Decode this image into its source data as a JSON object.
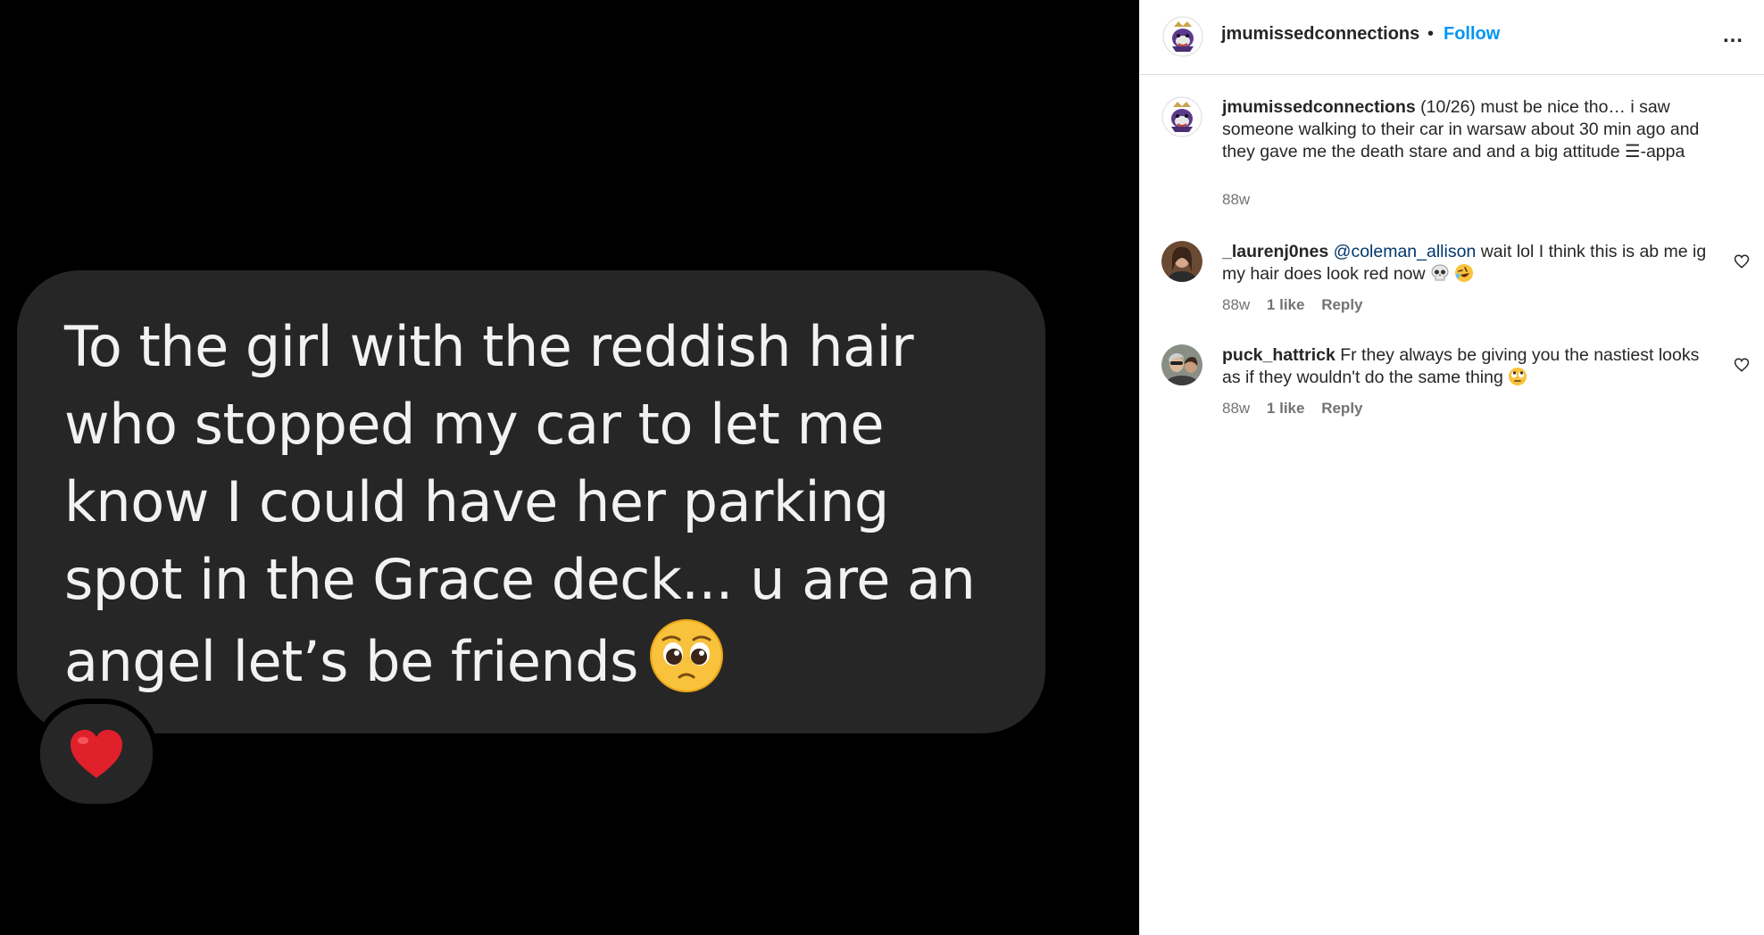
{
  "post_image": {
    "message": "To the girl with the reddish hair\nwho stopped my car to let me\nknow I could have her parking\nspot in the Grace deck... u are an\nangel let’s be friends",
    "emoji_icon": "pleading-face-emoji",
    "reaction_icon": "red-heart-emoji",
    "bubble_color": "#262626",
    "text_color": "#f2f2f2"
  },
  "header": {
    "username": "jmumissedconnections",
    "separator": "•",
    "follow_label": "Follow",
    "more_label": "…",
    "follow_color": "#0095f6"
  },
  "caption": {
    "username": "jmumissedconnections",
    "text": "(10/26) must be nice tho… i saw someone walking to their car in warsaw about 30 min ago and they gave me the death stare and and a big attitude ☰-appa",
    "time": "88w"
  },
  "comments": [
    {
      "username": "_laurenj0nes",
      "mention": "@coleman_allison",
      "text": "wait lol I think this is ab me ig my hair does look red now",
      "emojis": [
        "skull-emoji",
        "rofl-emoji"
      ],
      "time": "88w",
      "likes": "1 like",
      "reply": "Reply"
    },
    {
      "username": "puck_hattrick",
      "text": "Fr they always be giving you the nastiest looks as if they wouldn't do the same thing",
      "emojis": [
        "eye-roll-emoji"
      ],
      "time": "88w",
      "likes": "1 like",
      "reply": "Reply"
    }
  ]
}
